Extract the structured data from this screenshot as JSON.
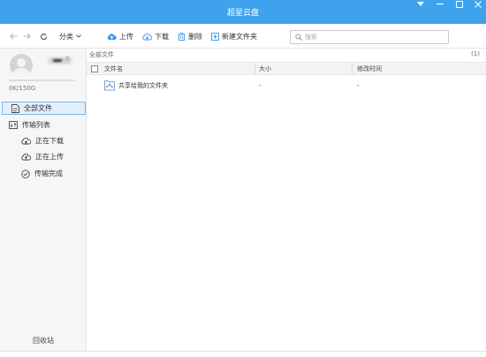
{
  "window": {
    "title": "超星云盘"
  },
  "toolbar": {
    "category_label": "分类",
    "upload_label": "上传",
    "download_label": "下载",
    "delete_label": "删除",
    "new_folder_label": "新建文件夹",
    "search_placeholder": "搜索"
  },
  "sidebar": {
    "quota_text": "0K/150G",
    "items": [
      {
        "label": "全部文件",
        "active": true
      },
      {
        "label": "传输列表"
      }
    ],
    "transfer_items": [
      {
        "label": "正在下载"
      },
      {
        "label": "正在上传"
      },
      {
        "label": "传输完成"
      }
    ],
    "recycle_label": "回收站"
  },
  "main": {
    "breadcrumb": "全部文件",
    "count": "(1)",
    "columns": [
      "文件名",
      "大小",
      "修改时间"
    ],
    "rows": [
      {
        "name": "共享给我的文件夹",
        "size": "-",
        "modified": "-"
      }
    ]
  },
  "colors": {
    "titlebar": "#3ea3ec",
    "accent": "#2f8ee0",
    "active_nav_bg": "#e3eefb"
  }
}
